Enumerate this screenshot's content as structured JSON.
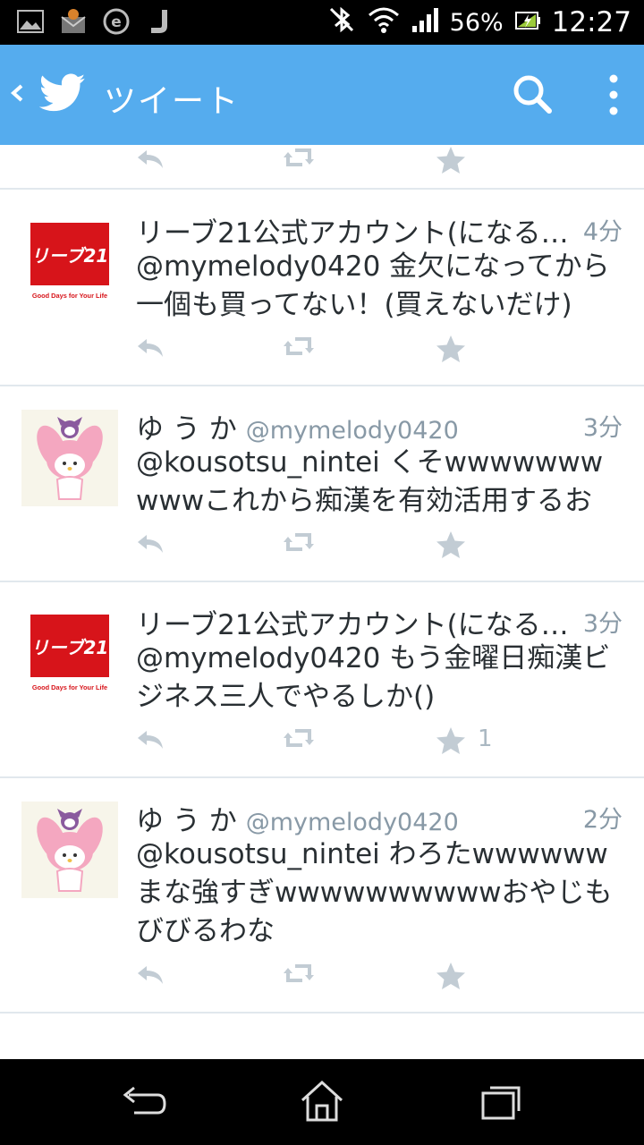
{
  "status_bar": {
    "battery": "56%",
    "time": "12:27",
    "notification_icons": [
      "image-icon",
      "mail-app-icon",
      "e-app-icon",
      "j-app-icon"
    ],
    "system_icons": [
      "bluetooth-icon",
      "wifi-icon",
      "signal-icon",
      "battery-icon"
    ]
  },
  "app_bar": {
    "title": "ツイート",
    "back_icon": "back-chevron-icon",
    "logo_icon": "twitter-bird-icon",
    "search_icon": "search-icon",
    "menu_icon": "overflow-menu-icon",
    "color": "#55acee"
  },
  "tweets": [
    {
      "name": "リーブ21公式アカウント(になる…",
      "handle": "",
      "time": "4分",
      "text": "@mymelody0420 金欠になってから一個も買ってない！(買えないだけ)",
      "avatar": "reve21-logo",
      "fav_count": ""
    },
    {
      "name": "ゆ う か",
      "handle": "@mymelody0420",
      "time": "3分",
      "text": "@kousotsu_nintei くそwwwwwwwwwwこれから痴漢を有効活用するお",
      "avatar": "my-melody-avatar",
      "fav_count": ""
    },
    {
      "name": "リーブ21公式アカウント(になる…",
      "handle": "",
      "time": "3分",
      "text": "@mymelody0420 もう金曜日痴漢ビジネス三人でやるしか()",
      "avatar": "reve21-logo",
      "fav_count": "1"
    },
    {
      "name": "ゆ う か",
      "handle": "@mymelody0420",
      "time": "2分",
      "text": "@kousotsu_nintei わろたwwwwwwまな強すぎwwwwwwwwwwおやじもびびるわな",
      "avatar": "my-melody-avatar",
      "fav_count": ""
    }
  ],
  "reve21": {
    "logo_text": "リーブ21",
    "tagline": "Good Days for Your Life",
    "color": "#d7141a"
  },
  "nav_bar": {
    "buttons": [
      "back-icon",
      "home-icon",
      "recent-apps-icon"
    ]
  },
  "colors": {
    "text": "#292f33",
    "secondary": "#8899a6",
    "action_icon": "#c2ccd4",
    "divider": "#e1e8ed"
  }
}
